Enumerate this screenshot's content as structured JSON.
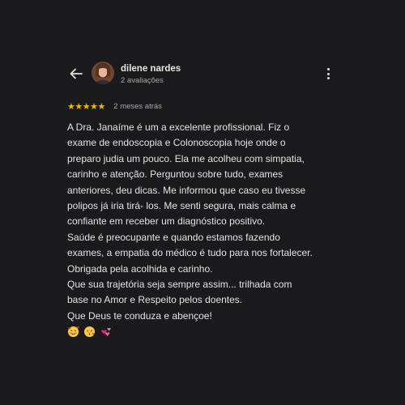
{
  "header": {
    "user_name": "dilene nardes",
    "review_count": "2 avaliações",
    "back_icon": "arrow-back-icon",
    "more_icon": "more-vert-icon"
  },
  "rating": {
    "stars": 5,
    "stars_text": "★★★★★",
    "date": "2 meses atrás",
    "star_color": "#f4b400"
  },
  "review": {
    "lines": [
      "A Dra. Janaíme é um a excelente profissional. Fiz o",
      "exame de endoscopia e Colonoscopia hoje onde o",
      "preparo judia um pouco. Ela me acolheu com simpatia,",
      "carinho e atenção. Perguntou sobre tudo, exames",
      "anteriores, deu dicas. Me informou que caso eu tivesse",
      "polipos já iria tirá- los. Me senti segura, mais calma e",
      "confiante em receber um diagnóstico positivo.",
      "Saúde é preocupante e quando estamos fazendo",
      "exames, a empatia do médico é tudo para nos fortalecer.",
      "Obrigada pela acolhida e carinho.",
      "Que sua trajetória seja sempre assim... trilhada com",
      "base no Amor e Respeito pelos doentes.",
      "Que Deus te conduza e abençoe!"
    ],
    "emojis": [
      "smiling-face-with-hearts",
      "face-blowing-kiss",
      "two-hearts"
    ]
  },
  "colors": {
    "background": "#1a1a1c",
    "text": "#e4e4e4",
    "muted": "#a8a8a8"
  }
}
